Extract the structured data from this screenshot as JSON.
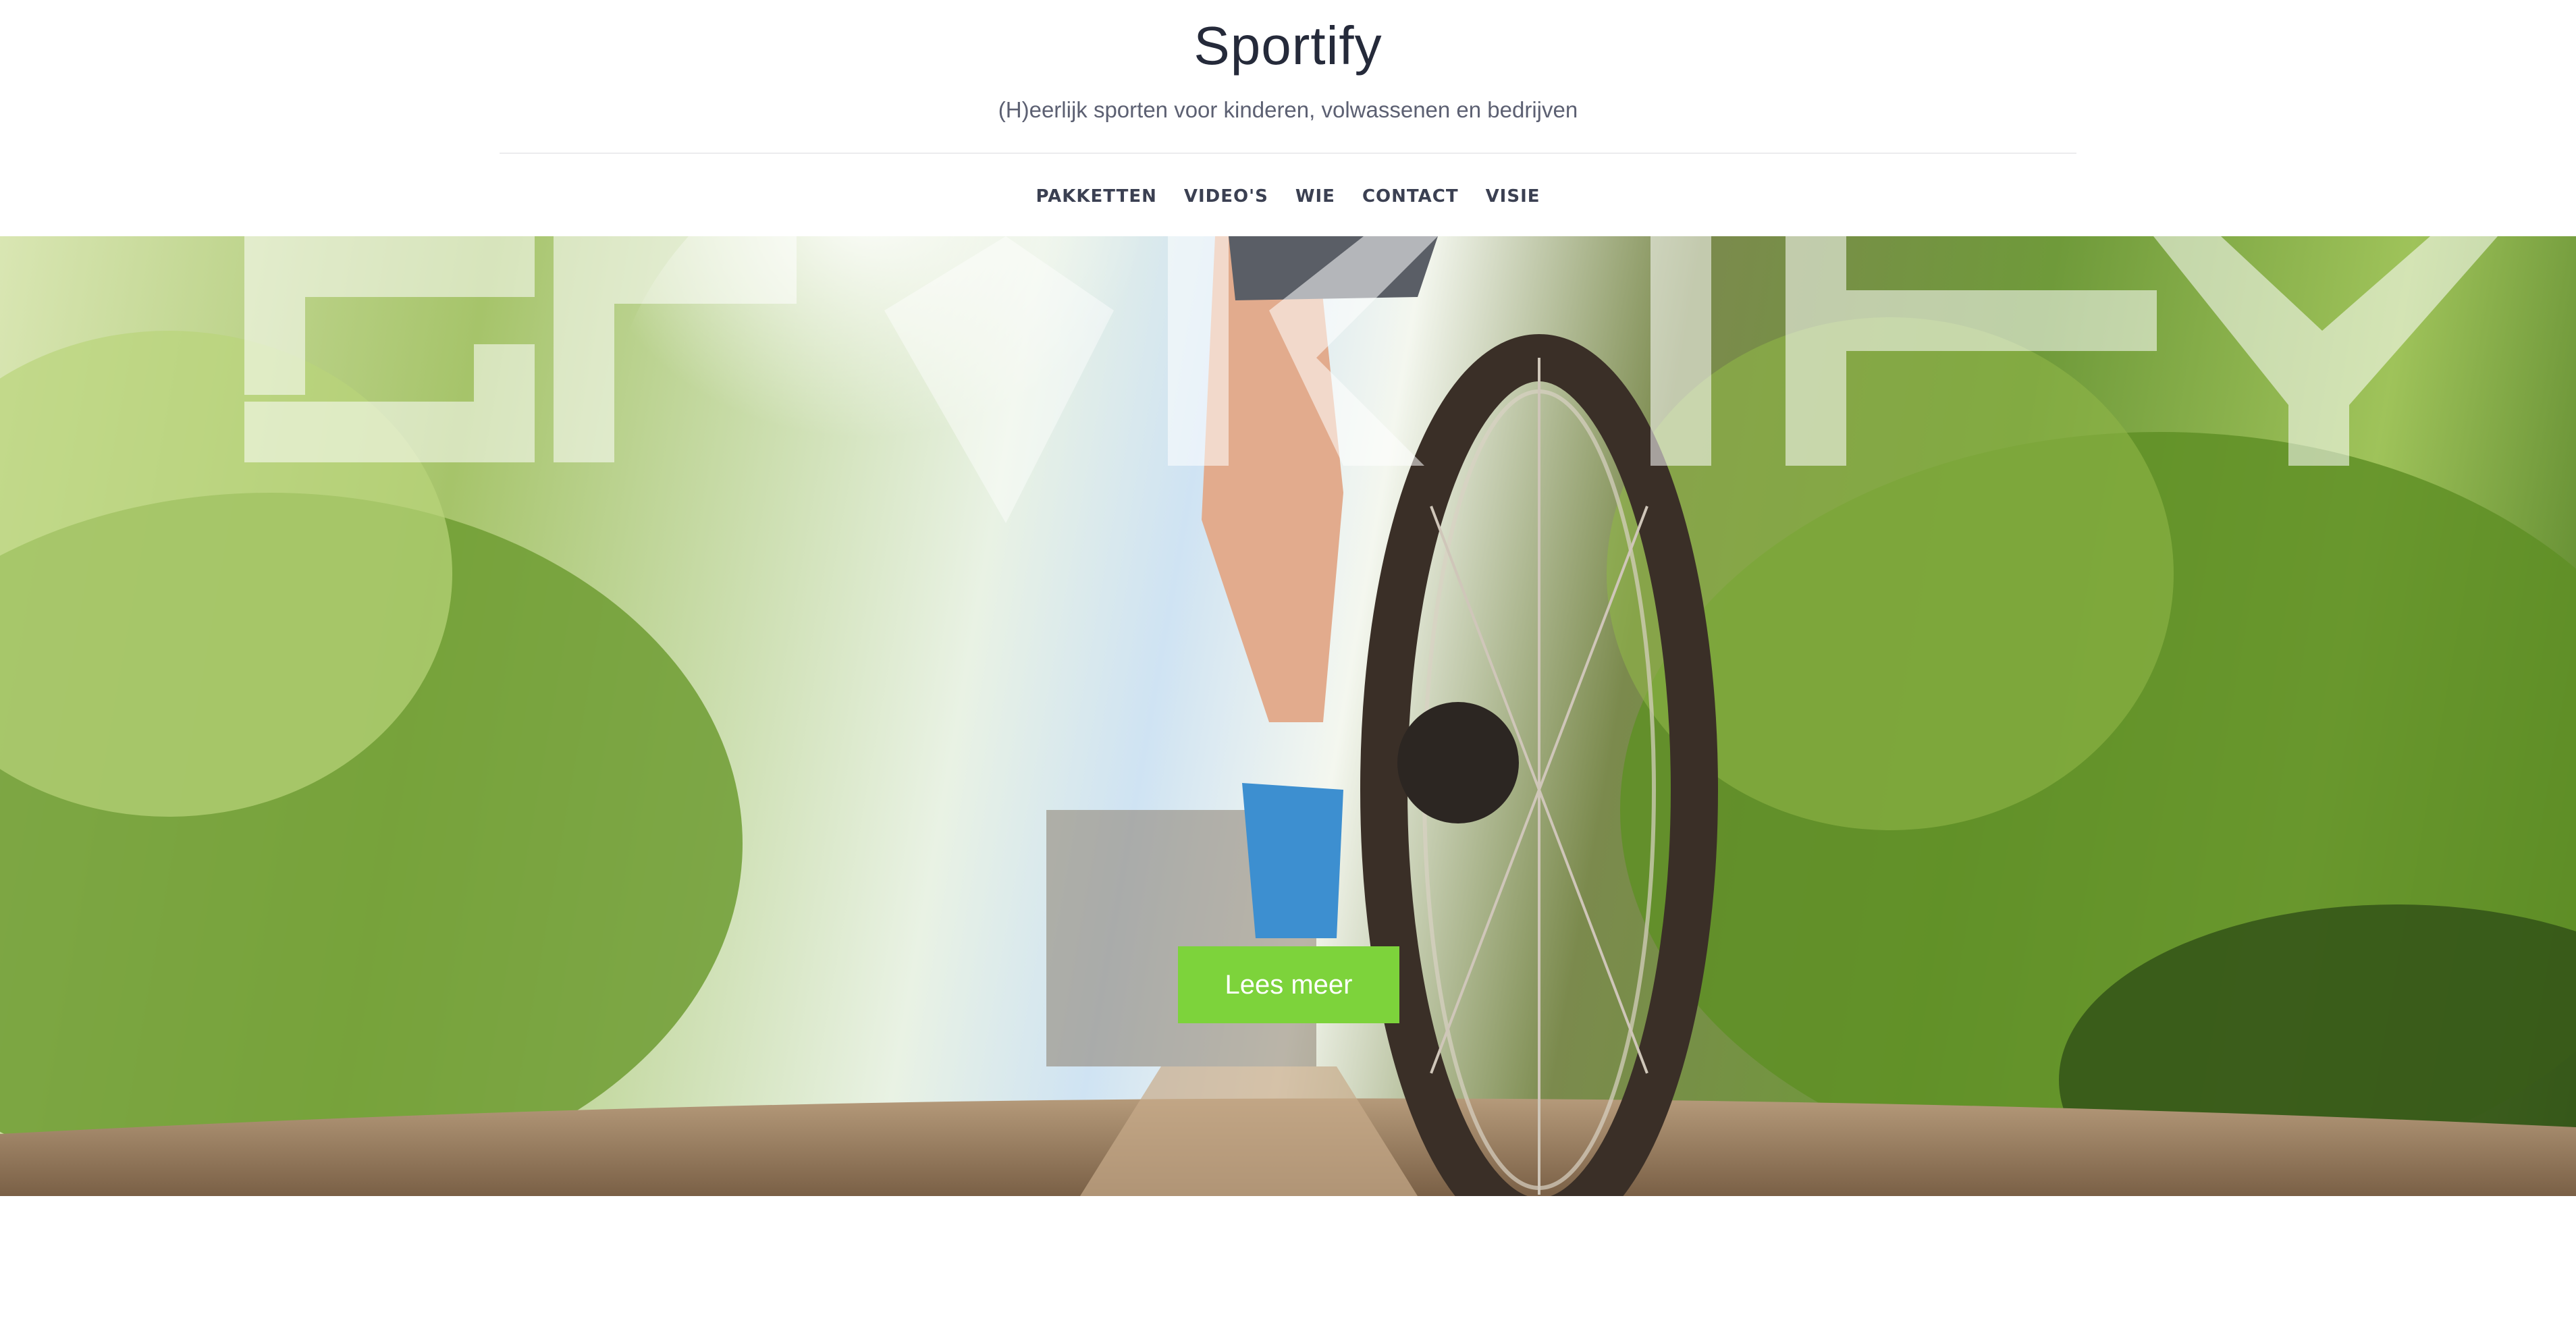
{
  "header": {
    "title": "Sportify",
    "tagline": "(H)eerlijk sporten voor kinderen, volwassenen en bedrijven"
  },
  "nav": {
    "items": [
      {
        "label": "PAKKETTEN"
      },
      {
        "label": "VIDEO'S"
      },
      {
        "label": "WIE"
      },
      {
        "label": "CONTACT"
      },
      {
        "label": "VISIE"
      }
    ]
  },
  "hero": {
    "watermark_text": "SPORTIFY",
    "cta_label": "Lees meer"
  },
  "colors": {
    "cta_background": "#7dd33b",
    "title_color": "#252a3a",
    "nav_color": "#3b4052"
  }
}
